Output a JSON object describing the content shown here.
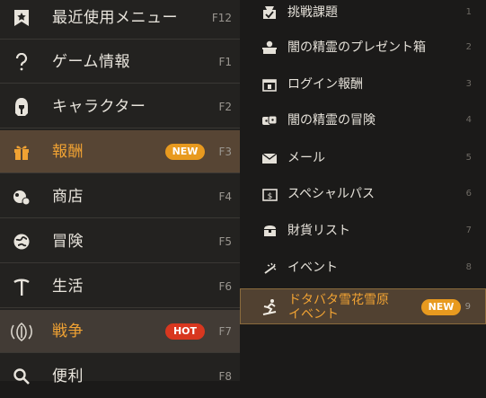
{
  "left_menu": {
    "items": [
      {
        "label": "最近使用メニュー",
        "key": "F12",
        "icon": "bookmark-star-icon"
      },
      {
        "label": "ゲーム情報",
        "key": "F1",
        "icon": "question-icon"
      },
      {
        "label": "キャラクター",
        "key": "F2",
        "icon": "helmet-icon"
      },
      {
        "label": "報酬",
        "key": "F3",
        "icon": "gift-icon",
        "badge": "NEW",
        "selected": true
      },
      {
        "label": "商店",
        "key": "F4",
        "icon": "shop-icon"
      },
      {
        "label": "冒険",
        "key": "F5",
        "icon": "globe-icon"
      },
      {
        "label": "生活",
        "key": "F6",
        "icon": "pickaxe-icon"
      },
      {
        "label": "戦争",
        "key": "F7",
        "icon": "shield-swords-icon",
        "badge": "HOT",
        "selected": true
      },
      {
        "label": "便利",
        "key": "F8",
        "icon": "magnifier-icon"
      }
    ]
  },
  "right_menu": {
    "items": [
      {
        "label": "挑戦課題",
        "num": "1",
        "icon": "challenge-icon"
      },
      {
        "label": "闇の精霊のプレゼント箱",
        "num": "2",
        "icon": "spirit-gift-icon"
      },
      {
        "label": "ログイン報酬",
        "num": "3",
        "icon": "calendar-icon"
      },
      {
        "label": "闇の精霊の冒険",
        "num": "4",
        "icon": "dice-icon"
      },
      {
        "label": "メール",
        "num": "5",
        "icon": "mail-icon"
      },
      {
        "label": "スペシャルパス",
        "num": "6",
        "icon": "pass-icon"
      },
      {
        "label": "財貨リスト",
        "num": "7",
        "icon": "chest-icon"
      },
      {
        "label": "イベント",
        "num": "8",
        "icon": "event-icon"
      },
      {
        "label": "ドタバタ雪花雪原\nイベント",
        "num": "9",
        "icon": "ski-icon",
        "badge": "NEW",
        "selected": true
      }
    ]
  },
  "colors": {
    "accent": "#f0a233",
    "new_badge": "#e89a1f",
    "hot_badge": "#d8371f"
  }
}
